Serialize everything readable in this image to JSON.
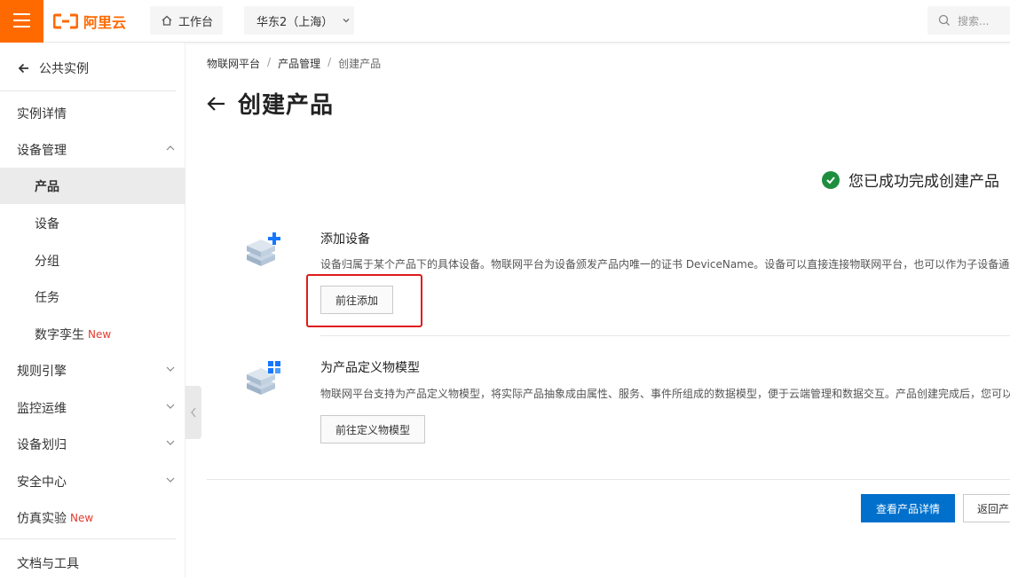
{
  "header": {
    "logo_text": "阿里云",
    "workbench_label": "工作台",
    "region_label": "华东2（上海）",
    "search_placeholder": "搜索..."
  },
  "sidebar": {
    "back_label": "公共实例",
    "items": [
      {
        "label": "实例详情"
      },
      {
        "label": "设备管理"
      },
      {
        "label": "产品"
      },
      {
        "label": "设备"
      },
      {
        "label": "分组"
      },
      {
        "label": "任务"
      },
      {
        "label": "数字孪生",
        "badge": "New"
      },
      {
        "label": "规则引擎"
      },
      {
        "label": "监控运维"
      },
      {
        "label": "设备划归"
      },
      {
        "label": "安全中心"
      },
      {
        "label": "仿真实验",
        "badge": "New"
      },
      {
        "label": "文档与工具"
      }
    ]
  },
  "breadcrumb": [
    "物联网平台",
    "产品管理",
    "创建产品"
  ],
  "page_title": "创建产品",
  "success_message": "您已成功完成创建产品",
  "cards": [
    {
      "title": "添加设备",
      "desc": "设备归属于某个产品下的具体设备。物联网平台为设备颁发产品内唯一的证书 DeviceName。设备可以直接连接物联网平台，也可以作为子设备通过",
      "button": "前往添加"
    },
    {
      "title": "为产品定义物模型",
      "desc": "物联网平台支持为产品定义物模型，将实际产品抽象成由属性、服务、事件所组成的数据模型，便于云端管理和数据交互。产品创建完成后，您可以",
      "button": "前往定义物模型"
    }
  ],
  "footer": {
    "primary_button": "查看产品详情",
    "secondary_button": "返回产"
  },
  "colors": {
    "brand": "#ff6a00",
    "primary": "#0070cc",
    "success": "#1e8e3e",
    "new_badge": "#e23b2e",
    "highlight": "#e01b1b"
  }
}
